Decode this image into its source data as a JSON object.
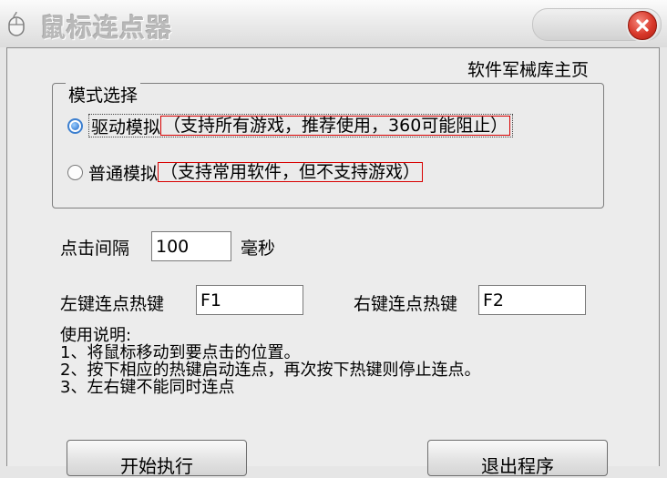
{
  "window": {
    "title": "鼠标连点器",
    "icon": "mouse-icon",
    "close_icon": "close-icon"
  },
  "homepage_link": "软件军械库主页",
  "mode_group": {
    "title": "模式选择",
    "options": [
      {
        "label": "驱动模拟",
        "description": "（支持所有游戏，推荐使用，360可能阻止）",
        "checked": true
      },
      {
        "label": "普通模拟",
        "description": "（支持常用软件，但不支持游戏）",
        "checked": false
      }
    ]
  },
  "interval": {
    "label": "点击间隔",
    "value": "100",
    "unit": "毫秒"
  },
  "hotkeys": {
    "left_label": "左键连点热键",
    "left_value": "F1",
    "right_label": "右键连点热键",
    "right_value": "F2"
  },
  "instructions": {
    "heading": "使用说明:",
    "lines": [
      "1、将鼠标移动到要点击的位置。",
      "2、按下相应的热键启动连点，再次按下热键则停止连点。",
      "3、左右键不能同时连点"
    ]
  },
  "buttons": {
    "start": "开始执行",
    "exit": "退出程序"
  },
  "colors": {
    "highlight_border": "#d80000",
    "radio_accent": "#1f68c8",
    "close_red": "#d8382a"
  }
}
